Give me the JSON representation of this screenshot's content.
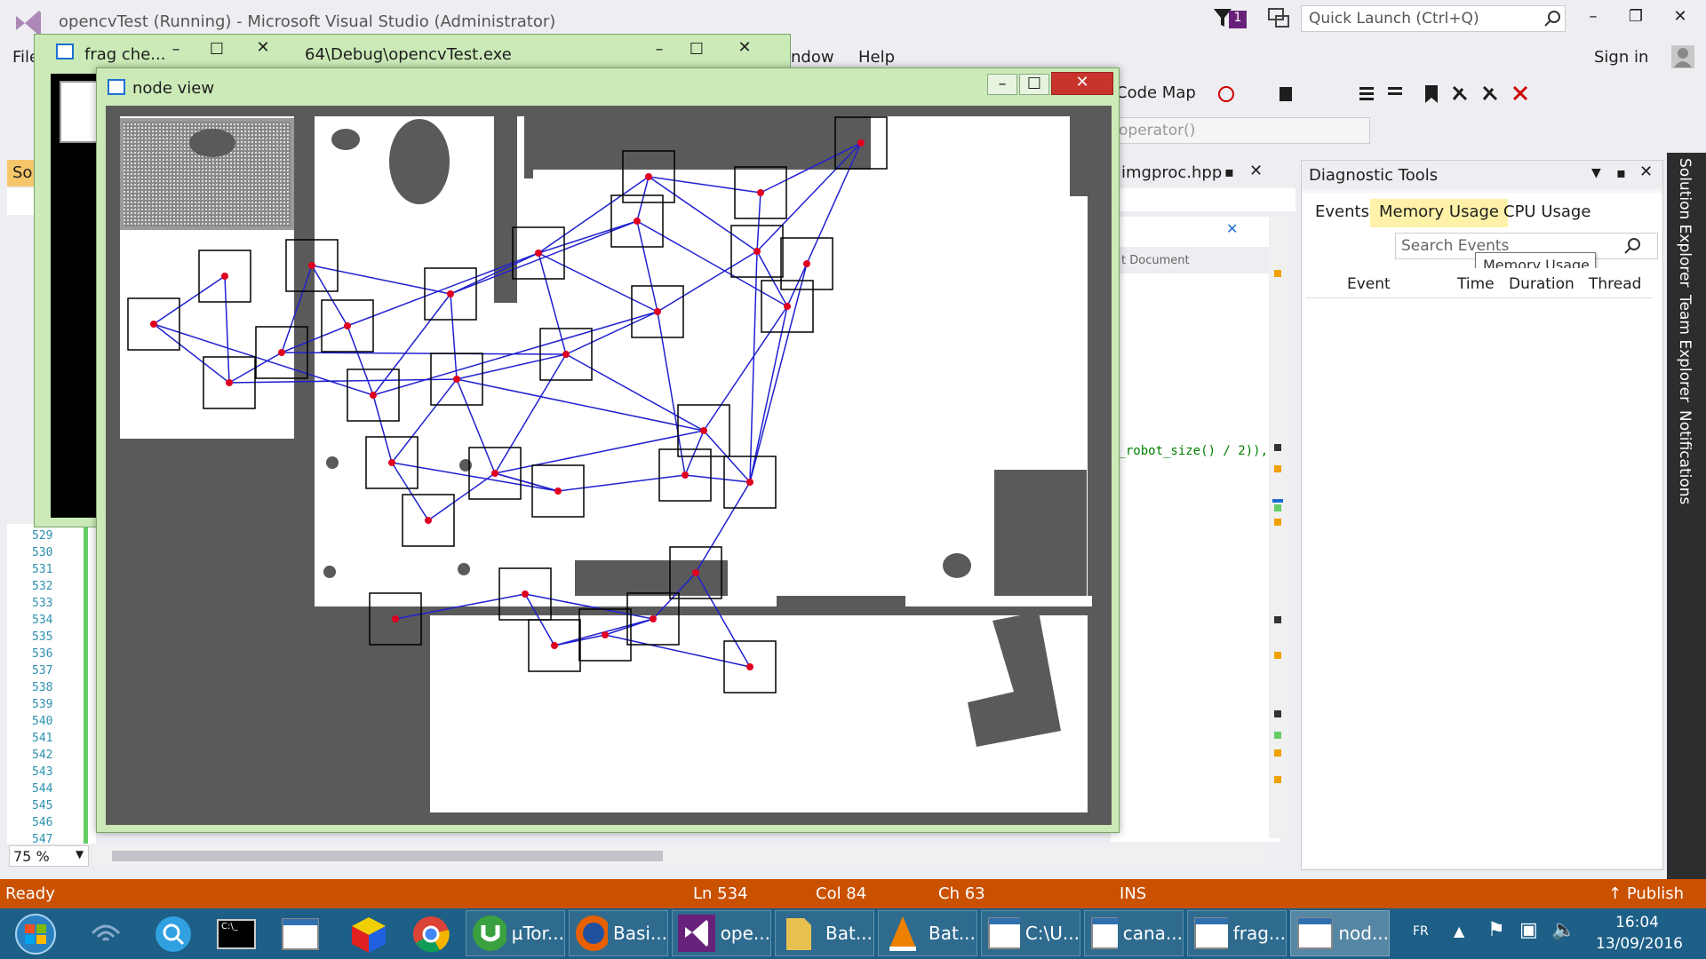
{
  "vs": {
    "title": "opencvTest (Running) - Microsoft Visual Studio (Administrator)",
    "notification_count": "1",
    "quick_launch_placeholder": "Quick Launch (Ctrl+Q)",
    "menu_file": "File",
    "menu_window": "ndow",
    "menu_help": "Help",
    "sign_in": "Sign in",
    "code_map": "Code Map",
    "operator_dropdown": "operator()",
    "editor_tab": "imgproc.hpp",
    "doc_dropdown": "t Document",
    "code_line": "t_robot_size() / 2)),",
    "zoom": "75 %",
    "solution_tab": "So",
    "line_numbers": [
      "529",
      "530",
      "531",
      "532",
      "533",
      "534",
      "535",
      "536",
      "537",
      "538",
      "539",
      "540",
      "541",
      "542",
      "543",
      "544",
      "545",
      "546",
      "547"
    ]
  },
  "frag_window": {
    "title": "frag che...",
    "path": "64\\Debug\\opencvTest.exe"
  },
  "node_view": {
    "title": "node view"
  },
  "diagnostic": {
    "title": "Diagnostic Tools",
    "tabs": [
      "Events",
      "Memory Usage",
      "CPU Usage"
    ],
    "search_placeholder": "Search Events",
    "tooltip": "Memory Usage",
    "columns": [
      "Event",
      "Time",
      "Duration",
      "Thread"
    ]
  },
  "side_tabs": [
    "Solution Explorer",
    "Team Explorer",
    "Notifications"
  ],
  "status": {
    "ready": "Ready",
    "ln": "Ln 534",
    "col": "Col 84",
    "ch": "Ch 63",
    "ins": "INS",
    "publish": "Publish"
  },
  "taskbar": {
    "items": [
      "µTor...",
      "Basi...",
      "ope...",
      "Bat...",
      "Bat...",
      "C:\\U...",
      "cana...",
      "frag...",
      "nod..."
    ],
    "lang": "FR",
    "time": "16:04",
    "date": "13/09/2016"
  },
  "colors": {
    "accent": "#ca5100",
    "graph_edge": "#2020d0",
    "node_marker": "#e00020",
    "obstacle": "#5a5a5a"
  }
}
